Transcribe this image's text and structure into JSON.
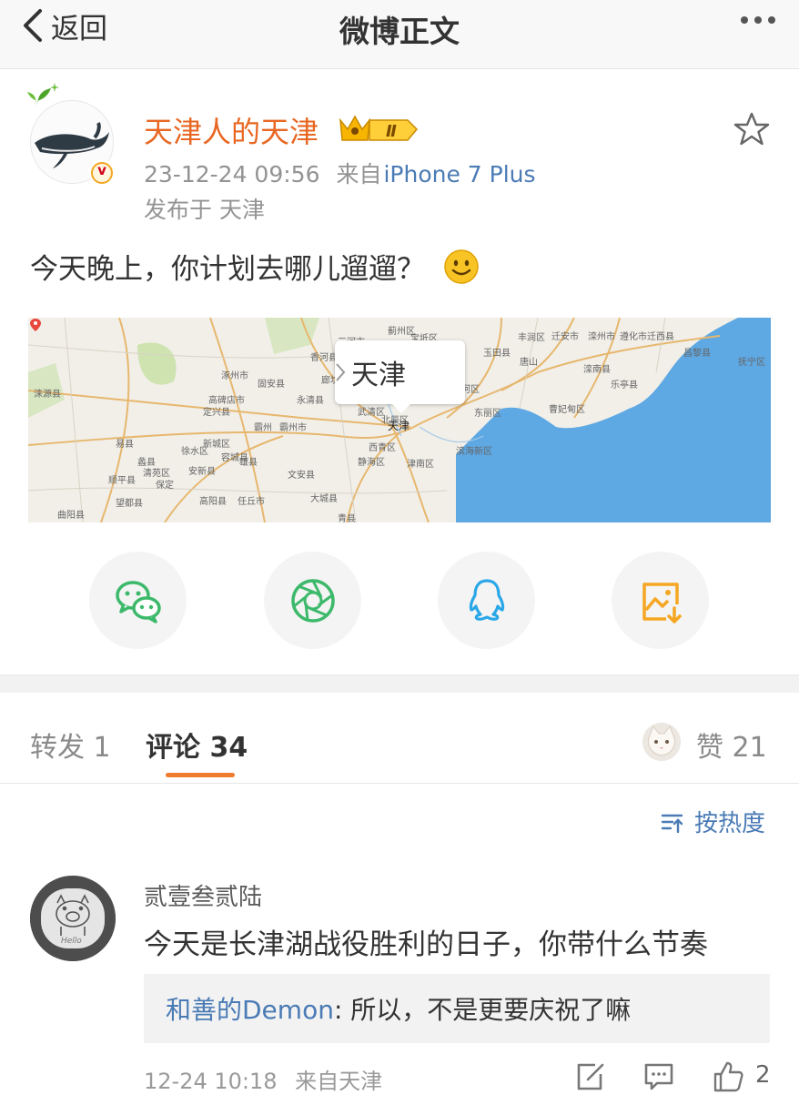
{
  "nav": {
    "back_label": "返回",
    "title": "微博正文"
  },
  "post": {
    "username": "天津人的天津",
    "vip_level": "Ⅱ",
    "date": "23-12-24 09:56",
    "source_prefix": "来自",
    "source_client": "iPhone 7 Plus",
    "location_line": "发布于 天津",
    "text": "今天晚上，你计划去哪儿遛遛？",
    "map": {
      "callout": "天津",
      "city_marker": "天津",
      "labels": [
        "涞源县",
        "易县",
        "涿州市",
        "高碑店市",
        "定兴县",
        "徐水区",
        "保定",
        "蠡县",
        "高阳县",
        "任丘市",
        "廊坊",
        "永清县",
        "霸州市",
        "文安县",
        "大城县",
        "静海区",
        "津南区",
        "滨海新区",
        "宁河区",
        "宝坻区",
        "唐山",
        "滦南县",
        "乐亭县",
        "曹妃甸区",
        "迁安市",
        "滦州市",
        "丰润区",
        "固安县",
        "雄县",
        "容城县",
        "安新县",
        "清苑区",
        "顺平县",
        "望都县",
        "曲阳县",
        "青县",
        "蓟州区",
        "三河市",
        "香河县",
        "武清区",
        "北辰区",
        "东丽区",
        "西青区",
        "玉田县",
        "遵化市",
        "迁西县",
        "昌黎县",
        "抚宁区",
        "霸州",
        "新城区"
      ]
    }
  },
  "share": [
    {
      "name": "wechat",
      "color": "#3db96b"
    },
    {
      "name": "moments",
      "color": "#3db96b"
    },
    {
      "name": "qq",
      "color": "#2aa7e8"
    },
    {
      "name": "save-image",
      "color": "#f5a623"
    }
  ],
  "tabs": {
    "repost": "转发 1",
    "comment": "评论 34",
    "like": "赞 21"
  },
  "sort_label": "按热度",
  "comment": {
    "author": "贰壹叁贰陆",
    "text": "今天是长津湖战役胜利的日子，你带什么节奏",
    "reply_author": "和善的Demon",
    "reply_text": "所以，不是更要庆祝了嘛",
    "time": "12-24 10:18",
    "source": "来自天津",
    "like_count": "2"
  },
  "colors": {
    "accent": "#f07c2f",
    "link": "#4a7bb5",
    "username": "#e86722"
  }
}
